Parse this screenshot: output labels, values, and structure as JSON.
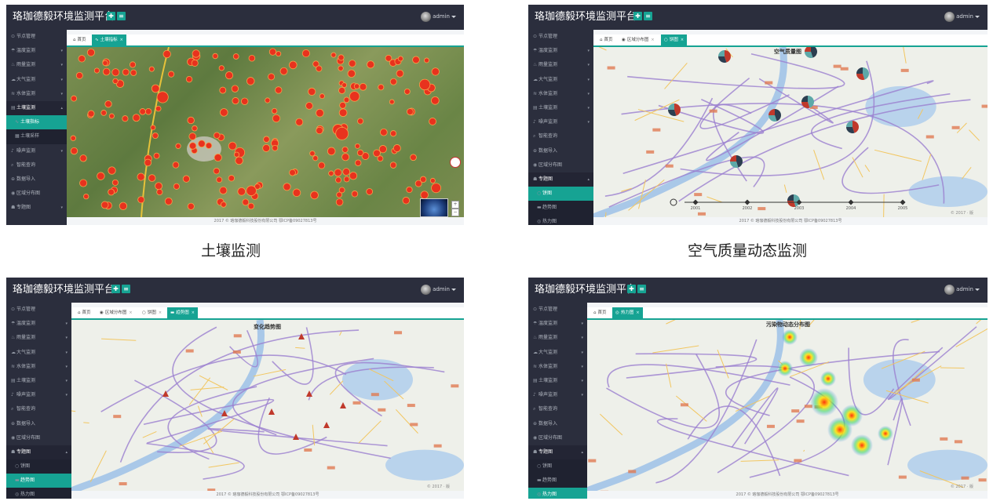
{
  "app_title": "珞珈德毅环境监测平台",
  "user_name": "admin",
  "footer_text": "2017 © 珞珈德毅科技股份有限公司 鄂ICP备09027813号",
  "copyright_map": "© 2017 · 版",
  "sidebar_a": {
    "items": [
      {
        "icon": "⊙",
        "label": "节点管理"
      },
      {
        "icon": "☂",
        "label": "温度监测",
        "arrow": "▾"
      },
      {
        "icon": "♨",
        "label": "雨量监测",
        "arrow": "▾"
      },
      {
        "icon": "☁",
        "label": "大气监测",
        "arrow": "▾"
      },
      {
        "icon": "≋",
        "label": "水体监测",
        "arrow": "▾"
      },
      {
        "icon": "▤",
        "label": "土壤监测",
        "arrow": "▴",
        "group": true
      },
      {
        "icon": "∿",
        "label": "土壤指标",
        "sub": true,
        "active": true
      },
      {
        "icon": "▦",
        "label": "土壤采样",
        "sub": true
      },
      {
        "icon": "♪",
        "label": "噪声监测",
        "arrow": "▾"
      },
      {
        "icon": "⌕",
        "label": "智能查询"
      },
      {
        "icon": "⊕",
        "label": "数据导入"
      },
      {
        "icon": "◉",
        "label": "区域分布图"
      },
      {
        "icon": "☗",
        "label": "专题图",
        "arrow": "▾"
      }
    ]
  },
  "sidebar_full": {
    "items": [
      {
        "icon": "⊙",
        "label": "节点管理"
      },
      {
        "icon": "☂",
        "label": "温度监测",
        "arrow": "▾"
      },
      {
        "icon": "♨",
        "label": "雨量监测",
        "arrow": "▾"
      },
      {
        "icon": "☁",
        "label": "大气监测",
        "arrow": "▾"
      },
      {
        "icon": "≋",
        "label": "水体监测",
        "arrow": "▾"
      },
      {
        "icon": "▤",
        "label": "土壤监测",
        "arrow": "▾"
      },
      {
        "icon": "♪",
        "label": "噪声监测",
        "arrow": "▾"
      },
      {
        "icon": "⌕",
        "label": "智能查询"
      },
      {
        "icon": "⊕",
        "label": "数据导入"
      },
      {
        "icon": "◉",
        "label": "区域分布图"
      },
      {
        "icon": "☗",
        "label": "专题图",
        "arrow": "▴",
        "group": true
      },
      {
        "icon": "○",
        "label": "饼图",
        "sub": true
      },
      {
        "icon": "▬",
        "label": "趋势图",
        "sub": true
      },
      {
        "icon": "◎",
        "label": "热力图",
        "sub": true
      }
    ]
  },
  "tabs_a": [
    {
      "icon": "⌂",
      "label": "首页"
    },
    {
      "icon": "∿",
      "label": "土壤指标",
      "active": true,
      "close": "×"
    }
  ],
  "tabs_b": [
    {
      "icon": "⌂",
      "label": "首页"
    },
    {
      "icon": "◉",
      "label": "区域分布图",
      "close": "×"
    },
    {
      "icon": "○",
      "label": "饼图",
      "active": true,
      "close": "×"
    }
  ],
  "tabs_c": [
    {
      "icon": "⌂",
      "label": "首页"
    },
    {
      "icon": "◉",
      "label": "区域分布图",
      "close": "×"
    },
    {
      "icon": "○",
      "label": "饼图",
      "close": "×"
    },
    {
      "icon": "▬",
      "label": "趋势图",
      "active": true,
      "close": "×"
    }
  ],
  "tabs_d": [
    {
      "icon": "⌂",
      "label": "首页"
    },
    {
      "icon": "◎",
      "label": "热力图",
      "active": true,
      "close": "×"
    }
  ],
  "active_sub": {
    "b": 11,
    "c": 12,
    "d": 13
  },
  "map_titles": {
    "b": "空气质量图",
    "c": "变化趋势图",
    "d": "污染物动态分布图"
  },
  "captions": {
    "a": "土壤监测",
    "b": "空气质量动态监测"
  },
  "timeline_labels": [
    "2001",
    "2002",
    "2003",
    "2004",
    "2005"
  ],
  "colors": {
    "accent": "#16a393",
    "topbar": "#2b2e3d",
    "soil_dot": "#e8321e",
    "pie_red": "#c0392b",
    "pie_dark": "#2c3e50",
    "pie_teal": "#5da8a8"
  }
}
